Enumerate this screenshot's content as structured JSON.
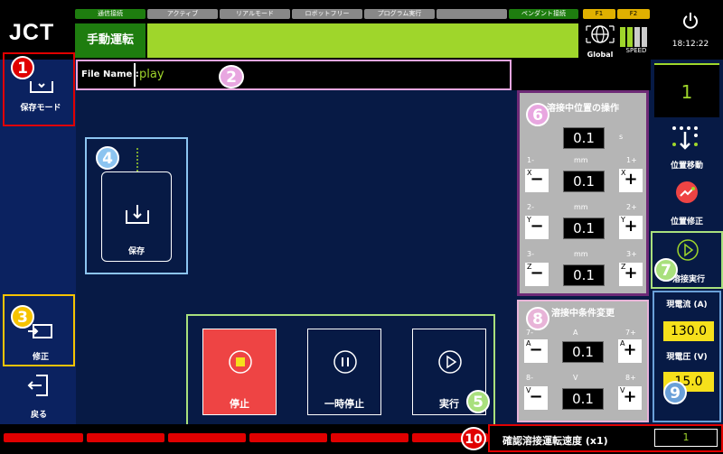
{
  "header": {
    "logo": "JCT",
    "status_tabs": [
      {
        "label": "通信接続",
        "active": true
      },
      {
        "label": "アクティブ",
        "active": false
      },
      {
        "label": "リアルモード",
        "active": false
      },
      {
        "label": "ロボットフリー",
        "active": false
      },
      {
        "label": "プログラム実行",
        "active": false
      },
      {
        "label": "",
        "active": false
      },
      {
        "label": "ペンダント接続",
        "active": true
      }
    ],
    "f_tabs": [
      "F1",
      "F2"
    ],
    "mode": "手動運転",
    "global_label": "Global",
    "speed_label": "SPEED",
    "time": "18:12:22"
  },
  "left_rail": {
    "save_mode": "保存モード",
    "edit": "修正",
    "back": "戻る"
  },
  "file": {
    "label": "File Name :",
    "value": "play"
  },
  "save_card": {
    "label": "保存"
  },
  "controls": {
    "stop": "停止",
    "pause": "一時停止",
    "run": "実行"
  },
  "weld_position": {
    "title": "溶接中位置の操作",
    "time_value": "0.1",
    "time_unit": "s",
    "rows": [
      {
        "minus": "1-",
        "unit": "mm",
        "plus": "1+",
        "axis": "X",
        "value": "0.1"
      },
      {
        "minus": "2-",
        "unit": "mm",
        "plus": "2+",
        "axis": "Y",
        "value": "0.1"
      },
      {
        "minus": "3-",
        "unit": "mm",
        "plus": "3+",
        "axis": "Z",
        "value": "0.1"
      }
    ]
  },
  "weld_condition": {
    "title": "溶接中条件変更",
    "rows": [
      {
        "minus": "7-",
        "unit": "A",
        "plus": "7+",
        "axis": "A",
        "value": "0.1"
      },
      {
        "minus": "8-",
        "unit": "V",
        "plus": "8+",
        "axis": "V",
        "value": "0.1"
      }
    ]
  },
  "right_rail": {
    "counter": "1",
    "move_position": "位置移動",
    "fix_position": "位置修正",
    "weld_run": "溶接実行",
    "current_label": "現電流 (A)",
    "current_value": "130.0",
    "voltage_label": "現電圧 (V)",
    "voltage_value": "15.0"
  },
  "footer": {
    "speed_label": "確認溶接運転速度 (x1)",
    "speed_value": "1"
  },
  "callouts": [
    "1",
    "2",
    "3",
    "4",
    "5",
    "6",
    "7",
    "8",
    "9",
    "10"
  ],
  "colors": {
    "accent_green": "#9fd62b",
    "mode_green": "#1e7d0f",
    "stop_red": "#ee4444",
    "callout_red": "#e00000",
    "callout_pink": "#e8a6e0",
    "callout_blue": "#8cc4f0",
    "callout_yellow": "#f6c300",
    "callout_green": "#a9e07d",
    "callout_purple": "#6e2a77",
    "callout_lightpink": "#e8b4d8",
    "callout_lightblue": "#6aa0d8"
  }
}
